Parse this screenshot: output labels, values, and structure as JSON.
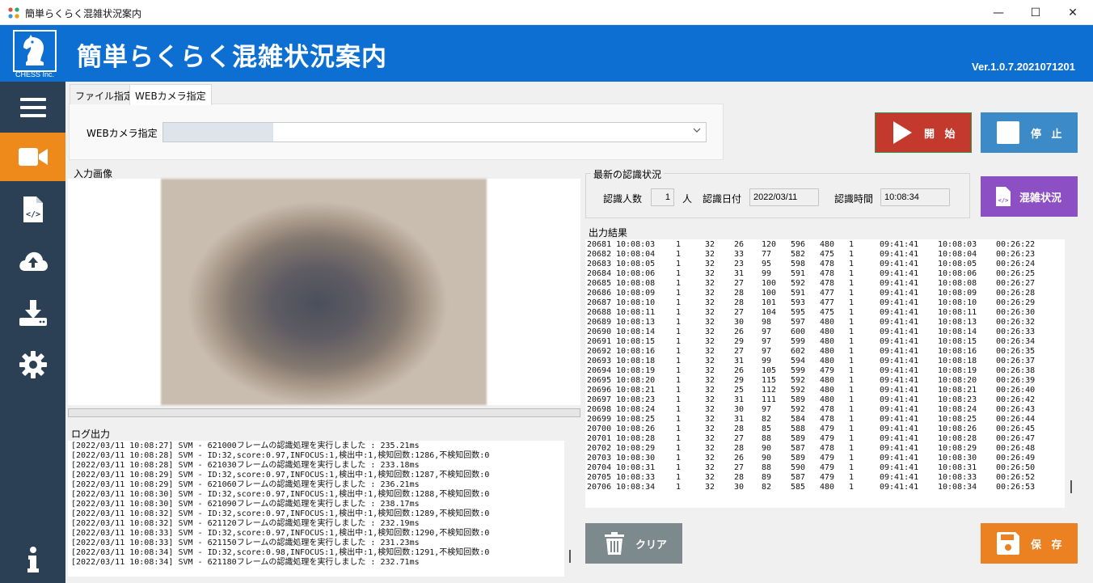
{
  "window": {
    "title": "簡単らくらく混雑状況案内",
    "minimize": "—",
    "maximize": "☐",
    "close": "✕"
  },
  "header": {
    "app_title": "簡単らくらく混雑状況案内",
    "company": "CHESS Inc.",
    "version": "Ver.1.0.7.2021071201"
  },
  "sidebar": {
    "items": [
      {
        "icon": "menu-icon"
      },
      {
        "icon": "video-camera-icon",
        "active": true
      },
      {
        "icon": "code-file-icon"
      },
      {
        "icon": "cloud-upload-icon"
      },
      {
        "icon": "download-icon"
      },
      {
        "icon": "gear-icon"
      },
      {
        "icon": "info-icon"
      }
    ],
    "colors": {
      "background": "#2b4055",
      "active": "#ee8a1c"
    }
  },
  "tabs": [
    {
      "label": "ファイル指定"
    },
    {
      "label": "WEBカメラ指定",
      "selected": true
    }
  ],
  "camera": {
    "label": "WEBカメラ指定",
    "selected": ""
  },
  "input_image_label": "入力画像",
  "log": {
    "label": "ログ出力",
    "lines": [
      "[2022/03/11 10:08:27] SVM - 621000フレームの認識処理を実行しました : 235.21ms",
      "[2022/03/11 10:08:28] SVM - ID:32,score:0.97,INFOCUS:1,検出中:1,検知回数:1286,不検知回数:0",
      "[2022/03/11 10:08:28] SVM - 621030フレームの認識処理を実行しました : 233.18ms",
      "[2022/03/11 10:08:29] SVM - ID:32,score:0.97,INFOCUS:1,検出中:1,検知回数:1287,不検知回数:0",
      "[2022/03/11 10:08:29] SVM - 621060フレームの認識処理を実行しました : 236.21ms",
      "[2022/03/11 10:08:30] SVM - ID:32,score:0.97,INFOCUS:1,検出中:1,検知回数:1288,不検知回数:0",
      "[2022/03/11 10:08:30] SVM - 621090フレームの認識処理を実行しました : 238.17ms",
      "[2022/03/11 10:08:32] SVM - ID:32,score:0.97,INFOCUS:1,検出中:1,検知回数:1289,不検知回数:0",
      "[2022/03/11 10:08:32] SVM - 621120フレームの認識処理を実行しました : 232.19ms",
      "[2022/03/11 10:08:33] SVM - ID:32,score:0.97,INFOCUS:1,検出中:1,検知回数:1290,不検知回数:0",
      "[2022/03/11 10:08:33] SVM - 621150フレームの認識処理を実行しました : 231.23ms",
      "[2022/03/11 10:08:34] SVM - ID:32,score:0.98,INFOCUS:1,検出中:1,検知回数:1291,不検知回数:0",
      "[2022/03/11 10:08:34] SVM - 621180フレームの認識処理を実行しました : 232.71ms"
    ]
  },
  "recognition": {
    "title": "最新の認識状況",
    "count_label": "認識人数",
    "count_value": "1",
    "count_unit": "人",
    "date_label": "認識日付",
    "date_value": "2022/03/11",
    "time_label": "認識時間",
    "time_value": "10:08:34"
  },
  "output": {
    "label": "出力結果",
    "rows": [
      [
        "20681",
        "10:08:03",
        "1",
        "32",
        "26",
        "120",
        "596",
        "480",
        "1",
        "09:41:41",
        "10:08:03",
        "00:26:22"
      ],
      [
        "20682",
        "10:08:04",
        "1",
        "32",
        "33",
        "77",
        "582",
        "475",
        "1",
        "09:41:41",
        "10:08:04",
        "00:26:23"
      ],
      [
        "20683",
        "10:08:05",
        "1",
        "32",
        "23",
        "95",
        "598",
        "478",
        "1",
        "09:41:41",
        "10:08:05",
        "00:26:24"
      ],
      [
        "20684",
        "10:08:06",
        "1",
        "32",
        "31",
        "99",
        "591",
        "478",
        "1",
        "09:41:41",
        "10:08:06",
        "00:26:25"
      ],
      [
        "20685",
        "10:08:08",
        "1",
        "32",
        "27",
        "100",
        "592",
        "478",
        "1",
        "09:41:41",
        "10:08:08",
        "00:26:27"
      ],
      [
        "20686",
        "10:08:09",
        "1",
        "32",
        "28",
        "100",
        "591",
        "477",
        "1",
        "09:41:41",
        "10:08:09",
        "00:26:28"
      ],
      [
        "20687",
        "10:08:10",
        "1",
        "32",
        "28",
        "101",
        "593",
        "477",
        "1",
        "09:41:41",
        "10:08:10",
        "00:26:29"
      ],
      [
        "20688",
        "10:08:11",
        "1",
        "32",
        "27",
        "104",
        "595",
        "475",
        "1",
        "09:41:41",
        "10:08:11",
        "00:26:30"
      ],
      [
        "20689",
        "10:08:13",
        "1",
        "32",
        "30",
        "98",
        "597",
        "480",
        "1",
        "09:41:41",
        "10:08:13",
        "00:26:32"
      ],
      [
        "20690",
        "10:08:14",
        "1",
        "32",
        "26",
        "97",
        "600",
        "480",
        "1",
        "09:41:41",
        "10:08:14",
        "00:26:33"
      ],
      [
        "20691",
        "10:08:15",
        "1",
        "32",
        "29",
        "97",
        "599",
        "480",
        "1",
        "09:41:41",
        "10:08:15",
        "00:26:34"
      ],
      [
        "20692",
        "10:08:16",
        "1",
        "32",
        "27",
        "97",
        "602",
        "480",
        "1",
        "09:41:41",
        "10:08:16",
        "00:26:35"
      ],
      [
        "20693",
        "10:08:18",
        "1",
        "32",
        "31",
        "99",
        "594",
        "480",
        "1",
        "09:41:41",
        "10:08:18",
        "00:26:37"
      ],
      [
        "20694",
        "10:08:19",
        "1",
        "32",
        "26",
        "105",
        "599",
        "479",
        "1",
        "09:41:41",
        "10:08:19",
        "00:26:38"
      ],
      [
        "20695",
        "10:08:20",
        "1",
        "32",
        "29",
        "115",
        "592",
        "480",
        "1",
        "09:41:41",
        "10:08:20",
        "00:26:39"
      ],
      [
        "20696",
        "10:08:21",
        "1",
        "32",
        "25",
        "112",
        "592",
        "480",
        "1",
        "09:41:41",
        "10:08:21",
        "00:26:40"
      ],
      [
        "20697",
        "10:08:23",
        "1",
        "32",
        "31",
        "111",
        "589",
        "480",
        "1",
        "09:41:41",
        "10:08:23",
        "00:26:42"
      ],
      [
        "20698",
        "10:08:24",
        "1",
        "32",
        "30",
        "97",
        "592",
        "478",
        "1",
        "09:41:41",
        "10:08:24",
        "00:26:43"
      ],
      [
        "20699",
        "10:08:25",
        "1",
        "32",
        "31",
        "82",
        "584",
        "478",
        "1",
        "09:41:41",
        "10:08:25",
        "00:26:44"
      ],
      [
        "20700",
        "10:08:26",
        "1",
        "32",
        "28",
        "85",
        "588",
        "479",
        "1",
        "09:41:41",
        "10:08:26",
        "00:26:45"
      ],
      [
        "20701",
        "10:08:28",
        "1",
        "32",
        "27",
        "88",
        "589",
        "479",
        "1",
        "09:41:41",
        "10:08:28",
        "00:26:47"
      ],
      [
        "20702",
        "10:08:29",
        "1",
        "32",
        "28",
        "90",
        "587",
        "478",
        "1",
        "09:41:41",
        "10:08:29",
        "00:26:48"
      ],
      [
        "20703",
        "10:08:30",
        "1",
        "32",
        "26",
        "90",
        "589",
        "479",
        "1",
        "09:41:41",
        "10:08:30",
        "00:26:49"
      ],
      [
        "20704",
        "10:08:31",
        "1",
        "32",
        "27",
        "88",
        "590",
        "479",
        "1",
        "09:41:41",
        "10:08:31",
        "00:26:50"
      ],
      [
        "20705",
        "10:08:33",
        "1",
        "32",
        "28",
        "89",
        "587",
        "479",
        "1",
        "09:41:41",
        "10:08:33",
        "00:26:52"
      ],
      [
        "20706",
        "10:08:34",
        "1",
        "32",
        "30",
        "82",
        "585",
        "480",
        "1",
        "09:41:41",
        "10:08:34",
        "00:26:53"
      ]
    ]
  },
  "buttons": {
    "start": "開 始",
    "stop": "停 止",
    "congestion": "混雑状況",
    "clear": "クリア",
    "save": "保 存"
  },
  "colors": {
    "header": "#0d6fd1",
    "start": "#c4392d",
    "stop": "#3d8ac8",
    "congestion": "#8d4fc4",
    "clear": "#7c8a8d",
    "save": "#ec8121"
  }
}
